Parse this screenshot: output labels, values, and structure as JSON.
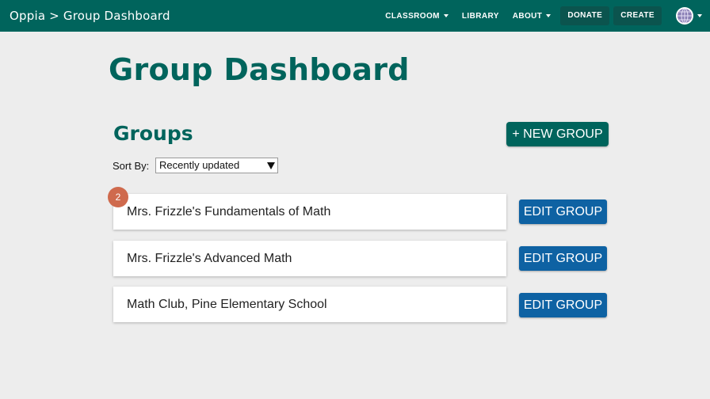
{
  "header": {
    "breadcrumb": "Oppia > Group Dashboard",
    "nav": {
      "classroom": "CLASSROOM",
      "library": "LIBRARY",
      "about": "ABOUT",
      "donate": "DONATE",
      "create": "CREATE"
    },
    "avatar_icon": "globe-avatar-icon"
  },
  "page": {
    "title": "Group Dashboard",
    "section_title": "Groups",
    "new_group_label": "+ NEW GROUP",
    "sort_label": "Sort By:",
    "sort_value": "Recently updated"
  },
  "groups": [
    {
      "name": "Mrs. Frizzle's Fundamentals of Math",
      "edit_label": "EDIT GROUP"
    },
    {
      "name": "Mrs. Frizzle's Advanced Math",
      "edit_label": "EDIT GROUP"
    },
    {
      "name": "Math Club, Pine Elementary School",
      "edit_label": "EDIT GROUP"
    }
  ],
  "badge": {
    "value": "2"
  },
  "colors": {
    "header_bg": "#00645c",
    "primary": "#00645c",
    "edit_button": "#0e62a3",
    "badge": "#cf6a4d",
    "page_bg": "#ededed"
  }
}
